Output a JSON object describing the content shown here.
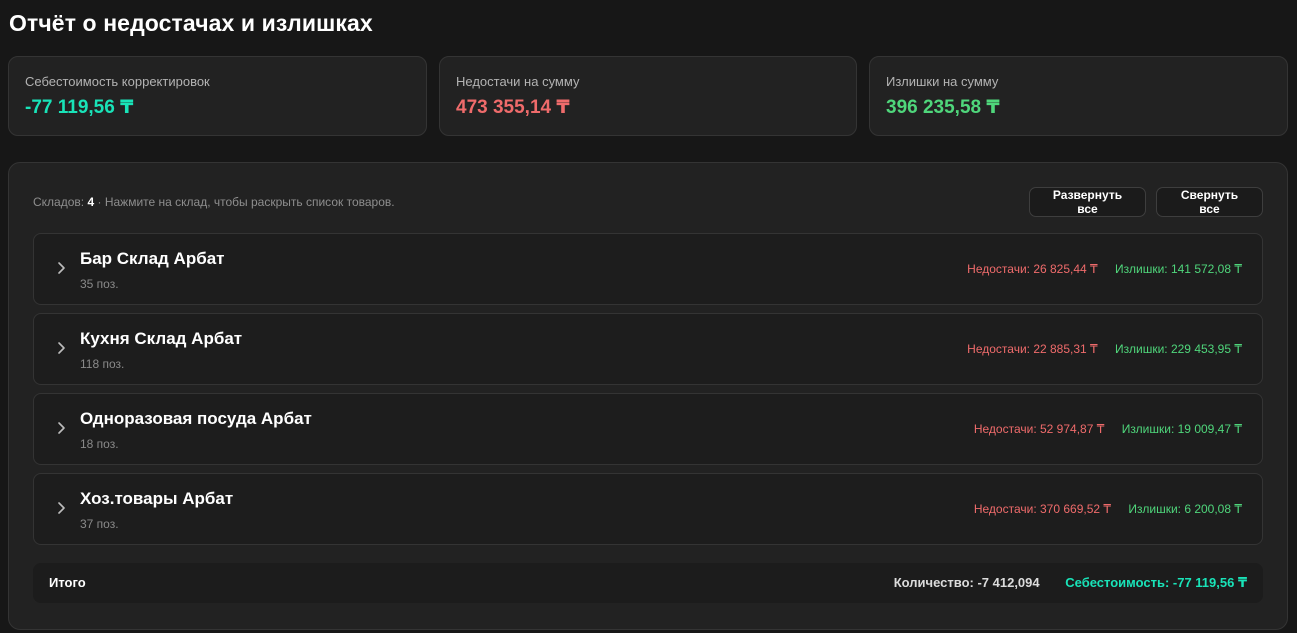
{
  "page": {
    "title": "Отчёт о недостачах и излишках"
  },
  "summary": [
    {
      "label": "Себестоимость корректировок",
      "value": "-77 119,56 ₸",
      "color": "#19e3b8"
    },
    {
      "label": "Недостачи на сумму",
      "value": "473 355,14 ₸",
      "color": "#ef6b6b"
    },
    {
      "label": "Излишки на сумму",
      "value": "396 235,58 ₸",
      "color": "#4fd67b"
    }
  ],
  "warehouses_panel": {
    "hint_prefix": "Складов:",
    "hint_count": "4",
    "hint_suffix": "· Нажмите на склад, чтобы раскрыть список товаров.",
    "expand_all_label": "Развернуть все",
    "collapse_all_label": "Свернуть все",
    "chevron_icon": "chevron-right-icon",
    "items": [
      {
        "name": "Бар Склад Арбат",
        "count": "35 поз.",
        "shortage": "Недостачи: 26 825,44 ₸",
        "surplus": "Излишки: 141 572,08 ₸"
      },
      {
        "name": "Кухня Склад Арбат",
        "count": "118 поз.",
        "shortage": "Недостачи: 22 885,31 ₸",
        "surplus": "Излишки: 229 453,95 ₸"
      },
      {
        "name": "Одноразовая посуда Арбат",
        "count": "18 поз.",
        "shortage": "Недостачи: 52 974,87 ₸",
        "surplus": "Излишки: 19 009,47 ₸"
      },
      {
        "name": "Хоз.товары Арбат",
        "count": "37 поз.",
        "shortage": "Недостачи: 370 669,52 ₸",
        "surplus": "Излишки: 6 200,08 ₸"
      }
    ],
    "totals": {
      "label": "Итого",
      "quantity": "Количество: -7 412,094",
      "cost": "Себестоимость: -77 119,56 ₸"
    }
  }
}
